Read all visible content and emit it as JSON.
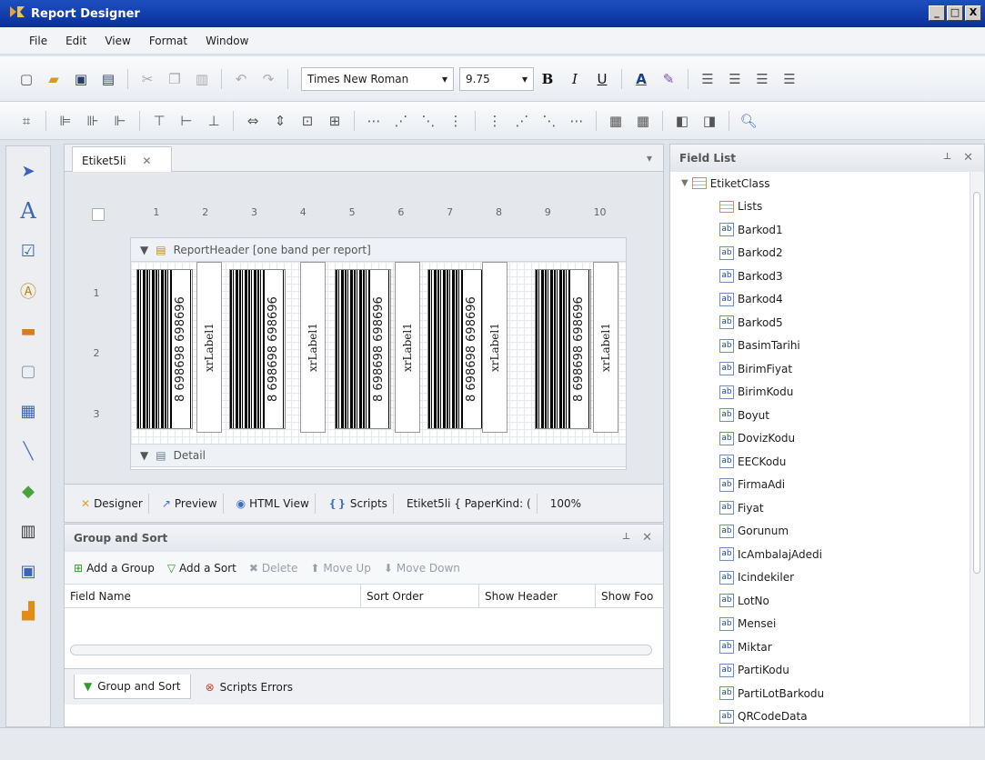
{
  "window": {
    "title": "Report Designer",
    "controls": [
      "_",
      "□",
      "X"
    ]
  },
  "menu": [
    "File",
    "Edit",
    "View",
    "Format",
    "Window"
  ],
  "toolbar": {
    "font_name": "Times New Roman",
    "font_size": "9.75",
    "bold": "B",
    "italic": "I",
    "underline": "U",
    "font_color": "A"
  },
  "document_tab": {
    "label": "Etiket5li"
  },
  "ruler": [
    "1",
    "2",
    "3",
    "4",
    "5",
    "6",
    "7",
    "8",
    "9",
    "10"
  ],
  "vruler": [
    "1",
    "2",
    "3"
  ],
  "bands": {
    "header": "ReportHeader [one band per report]",
    "detail": "Detail"
  },
  "barcodes": [
    {
      "number": "8 698698 698696"
    },
    {
      "number": "8 698698 698696"
    },
    {
      "number": "8 698698 698696"
    },
    {
      "number": "8 698698 698696"
    },
    {
      "number": "8 698698 698696"
    }
  ],
  "label_text": "xrLabel1",
  "doc_tabs": {
    "designer": "Designer",
    "preview": "Preview",
    "html": "HTML View",
    "scripts": "Scripts",
    "info": "Etiket5li { PaperKind: (",
    "zoom": "100%"
  },
  "group_sort": {
    "title": "Group and Sort",
    "add_group": "Add a Group",
    "add_sort": "Add a Sort",
    "delete": "Delete",
    "move_up": "Move Up",
    "move_down": "Move Down",
    "columns": [
      "Field Name",
      "Sort Order",
      "Show Header",
      "Show Foo"
    ],
    "tabs": [
      "Group and Sort",
      "Scripts Errors"
    ]
  },
  "field_list": {
    "title": "Field List",
    "root": "EtiketClass",
    "lists": "Lists",
    "fields": [
      "Barkod1",
      "Barkod2",
      "Barkod3",
      "Barkod4",
      "Barkod5",
      "BasimTarihi",
      "BirimFiyat",
      "BirimKodu",
      "Boyut",
      "DovizKodu",
      "EECKodu",
      "FirmaAdi",
      "Fiyat",
      "Gorunum",
      "IcAmbalajAdedi",
      "Icindekiler",
      "LotNo",
      "Mensei",
      "Miktar",
      "PartiKodu",
      "PartiLotBarkodu",
      "QRCodeData"
    ]
  }
}
